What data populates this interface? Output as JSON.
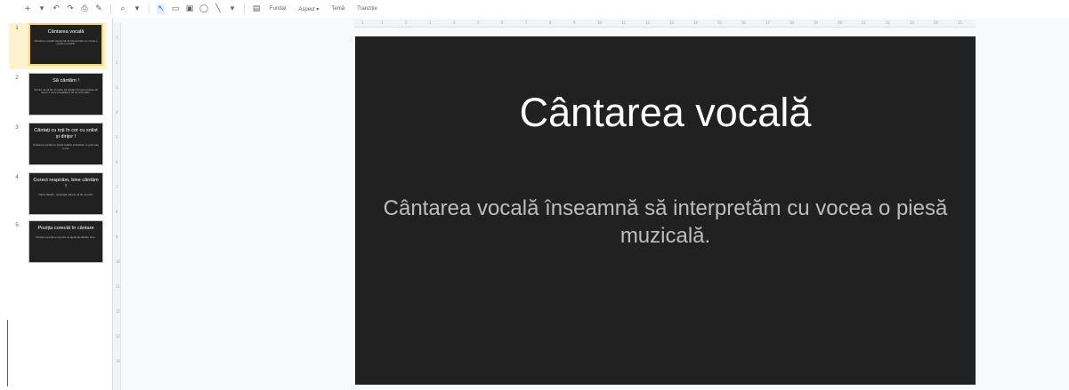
{
  "toolbar": {
    "icons": [
      "add-icon",
      "chevron-down-icon",
      "undo-icon",
      "redo-icon",
      "print-icon",
      "paint-format-icon",
      "zoom-icon",
      "select-icon",
      "textbox-icon",
      "image-icon",
      "shape-icon",
      "line-icon",
      "comment-icon"
    ],
    "background_label": "Fundal",
    "layout_label": "Aspect ▾",
    "theme_label": "Temă",
    "transition_label": "Tranziție"
  },
  "filmstrip": {
    "slides": [
      {
        "number": "1",
        "title": "Cântarea vocală",
        "body": "Cântarea vocală înseamnă să interpretăm cu vocea o piesă muzicală."
      },
      {
        "number": "2",
        "title": "Să cântăm !",
        "body": "Pentru ca să fim în stare să cântăm frumos trebuie să avem o voce pregătită și să ne antrenăm."
      },
      {
        "number": "3",
        "title": "Cântați cu toți în cor cu solist și dirijor !",
        "body": "Cântarea vocală se poate realiza individual, în grup sau în cor."
      },
      {
        "number": "4",
        "title": "Corect respirăm, bine cântăm !",
        "body": "Când cântăm, respirația trebuie să fie corectă."
      },
      {
        "number": "5",
        "title": "Poziția corectă în cântare",
        "body": "Poziția corectă a corpului ne ajută să cântăm bine."
      }
    ]
  },
  "ruler": {
    "horizontal": [
      "1",
      "1",
      "2",
      "3",
      "4",
      "5",
      "6",
      "7",
      "8",
      "9",
      "10",
      "11",
      "12",
      "13",
      "14",
      "15",
      "16",
      "17",
      "18",
      "19",
      "20",
      "21",
      "22",
      "23",
      "24",
      "25"
    ],
    "vertical": [
      "1",
      "2",
      "3",
      "4",
      "5",
      "6",
      "7",
      "8",
      "9",
      "10",
      "11",
      "12",
      "13",
      "14"
    ]
  },
  "slide": {
    "title": "Cântarea vocală",
    "body": "Cântarea vocală înseamnă să interpretăm cu vocea o piesă muzicală."
  },
  "colors": {
    "slide_background": "#212121",
    "selected_thumb_border": "#f9d776",
    "selected_thumb_background": "#fdf3d0",
    "accent": "#1a73e8"
  }
}
